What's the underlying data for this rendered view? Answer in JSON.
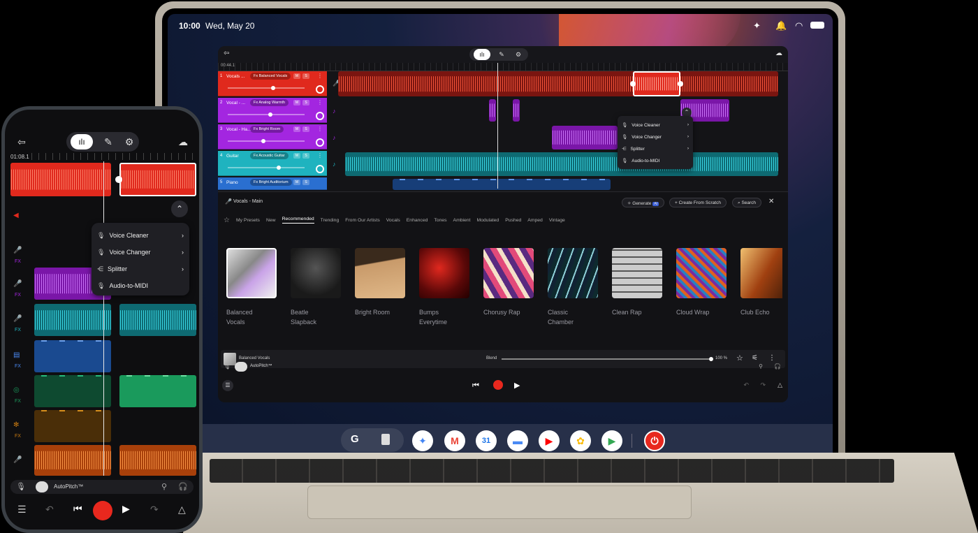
{
  "status_bar": {
    "time": "10:00",
    "date": "Wed, May 20"
  },
  "laptop_app": {
    "timecode": "00:44.1",
    "tracks": [
      {
        "num": "1",
        "name": "Vocals ...",
        "preset": "Balanced Vocals",
        "mute": "M",
        "solo": "S",
        "color": "#e0291d"
      },
      {
        "num": "2",
        "name": "Vocal - ...",
        "preset": "Analog Warmth",
        "mute": "M",
        "solo": "S",
        "color": "#a326e0"
      },
      {
        "num": "3",
        "name": "Vocal - Ha...",
        "preset": "Bright Room",
        "mute": "M",
        "solo": "S",
        "color": "#a326e0"
      },
      {
        "num": "4",
        "name": "Guitar",
        "preset": "Acoustic Guitar",
        "mute": "M",
        "solo": "S",
        "color": "#1fb3bf"
      },
      {
        "num": "5",
        "name": "Piano",
        "preset": "Bright Auditorium",
        "mute": "M",
        "solo": "S",
        "color": "#2a6fd0"
      }
    ],
    "context_menu": [
      "Voice Cleaner",
      "Voice Changer",
      "Splitter",
      "Audio-to-MIDI"
    ],
    "browser": {
      "track_name": "Vocals - Main",
      "generate": "Generate",
      "ai_badge": "AI",
      "create": "Create From Scratch",
      "search": "Search",
      "tabs": [
        "My Presets",
        "New",
        "Recommended",
        "Trending",
        "From Our Artists",
        "Vocals",
        "Enhanced",
        "Tones",
        "Ambient",
        "Modulated",
        "Pushed",
        "Amped",
        "Vintage"
      ],
      "active_tab": "Recommended",
      "presets": [
        {
          "line1": "Balanced",
          "line2": "Vocals"
        },
        {
          "line1": "Beatle",
          "line2": "Slapback"
        },
        {
          "line1": "Bright Room",
          "line2": ""
        },
        {
          "line1": "Bumps",
          "line2": "Everytime"
        },
        {
          "line1": "Chorusy Rap",
          "line2": ""
        },
        {
          "line1": "Classic",
          "line2": "Chamber"
        },
        {
          "line1": "Clean Rap",
          "line2": ""
        },
        {
          "line1": "Cloud Wrap",
          "line2": ""
        },
        {
          "line1": "Club Echo",
          "line2": ""
        }
      ],
      "selected_preset": "Balanced Vocals",
      "blend_label": "Blend",
      "blend_value": "100 %",
      "autopitch": "AutoPitch™"
    }
  },
  "dock": {
    "search_letter": "G",
    "apps": [
      "file",
      "gemini",
      "gmail",
      "calendar",
      "files",
      "youtube",
      "photos",
      "play",
      "bandlab"
    ],
    "calendar_day": "31"
  },
  "phone_app": {
    "timecode": "01:08.1",
    "context_menu": [
      "Voice Cleaner",
      "Voice Changer",
      "Splitter",
      "Audio-to-MIDI"
    ],
    "autopitch": "AutoPitch™"
  },
  "colors": {
    "red": "#e0291d",
    "purple": "#a326e0",
    "teal": "#1fb3bf",
    "blue": "#2a6fd0",
    "green": "#1a9a5c",
    "amber": "#c87a10",
    "orange": "#ff6a1a"
  }
}
